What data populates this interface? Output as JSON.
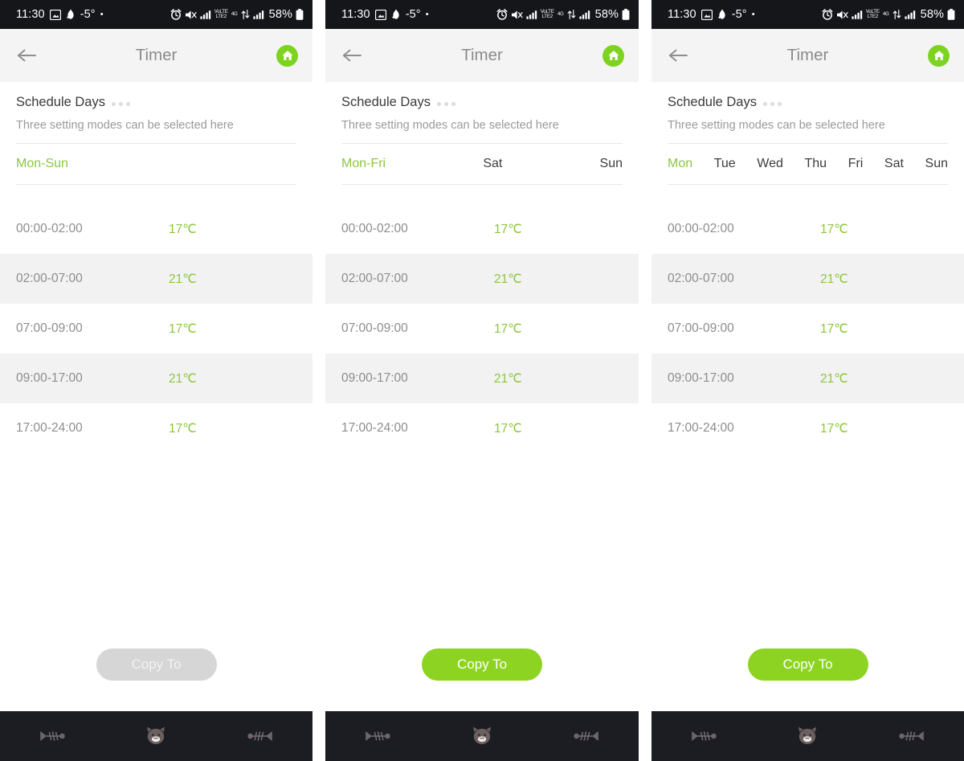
{
  "theme": {
    "accent_green": "#8dc63f",
    "button_green": "#8dd422",
    "status_bar_bg": "#14161a",
    "appbar_bg": "#f4f4f4",
    "row_alt_bg": "#f2f2f2",
    "disabled_gray": "#d6d6d6",
    "nav_bg": "#1b1d22"
  },
  "status_bar": {
    "time": "11:30",
    "temperature": "-5°",
    "battery_percent": "58%",
    "network_label": "VoLTE",
    "network_gen": "4G",
    "dot": "•",
    "icons": [
      "screenshot-icon",
      "weather-snow-icon",
      "alarm-icon",
      "mute-icon",
      "signal-bars-icon",
      "volte-icon",
      "data-transfer-icon",
      "signal-bars-2-icon",
      "battery-icon"
    ]
  },
  "appbar": {
    "title": "Timer",
    "back_icon": "back-arrow-icon",
    "home_icon": "home-icon"
  },
  "section": {
    "title": "Schedule Days",
    "subtitle": "Three setting modes can be selected here",
    "menu_icon": "more-dots-icon"
  },
  "panels": [
    {
      "id": "panel-mon-sun",
      "mode": "mode1",
      "day_tabs": [
        {
          "label": "Mon-Sun",
          "active": true
        }
      ],
      "copy_button": {
        "label": "Copy To",
        "enabled": false
      }
    },
    {
      "id": "panel-mon-fri-sat-sun",
      "mode": "mode2",
      "day_tabs": [
        {
          "label": "Mon-Fri",
          "active": true
        },
        {
          "label": "Sat",
          "active": false
        },
        {
          "label": "Sun",
          "active": false
        }
      ],
      "copy_button": {
        "label": "Copy To",
        "enabled": true
      }
    },
    {
      "id": "panel-each-day",
      "mode": "mode3",
      "day_tabs": [
        {
          "label": "Mon",
          "active": true
        },
        {
          "label": "Tue",
          "active": false
        },
        {
          "label": "Wed",
          "active": false
        },
        {
          "label": "Thu",
          "active": false
        },
        {
          "label": "Fri",
          "active": false
        },
        {
          "label": "Sat",
          "active": false
        },
        {
          "label": "Sun",
          "active": false
        }
      ],
      "copy_button": {
        "label": "Copy To",
        "enabled": true
      }
    }
  ],
  "schedule": [
    {
      "time": "00:00-02:00",
      "temp": "17℃"
    },
    {
      "time": "02:00-07:00",
      "temp": "21℃"
    },
    {
      "time": "07:00-09:00",
      "temp": "17℃"
    },
    {
      "time": "09:00-17:00",
      "temp": "21℃"
    },
    {
      "time": "17:00-24:00",
      "temp": "17℃"
    }
  ],
  "nav_bar": {
    "items": [
      {
        "name": "back-fishbone-icon"
      },
      {
        "name": "home-cat-icon"
      },
      {
        "name": "recents-fishbone-icon"
      }
    ]
  }
}
